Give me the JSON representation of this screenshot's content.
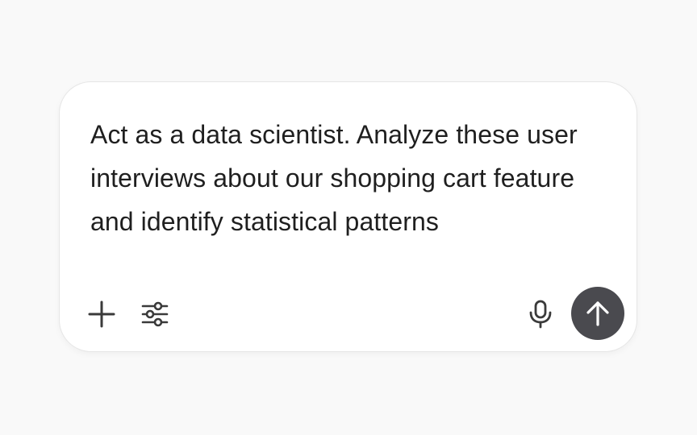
{
  "composer": {
    "prompt_text": "Act as a data scientist. Analyze these user interviews about our shopping cart feature and identify statistical patterns"
  },
  "toolbar": {
    "icons": {
      "add": "plus-icon",
      "tools": "sliders-icon",
      "voice": "microphone-icon",
      "send": "arrow-up-icon"
    }
  },
  "colors": {
    "background": "#f9f9f9",
    "card": "#ffffff",
    "text": "#1f1f1f",
    "icon": "#3a3a3a",
    "send_button": "#4a4a4f"
  }
}
